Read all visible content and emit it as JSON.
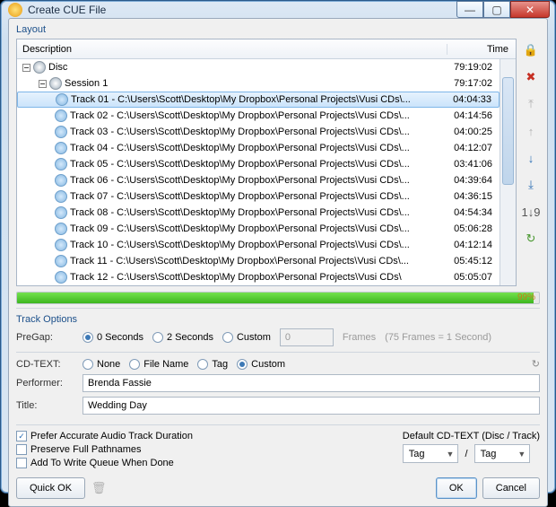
{
  "window": {
    "title": "Create CUE File"
  },
  "layout": {
    "label": "Layout",
    "columns": {
      "description": "Description",
      "time": "Time"
    },
    "root": {
      "label": "Disc",
      "time": "79:19:02"
    },
    "session": {
      "label": "Session 1",
      "time": "79:17:02"
    },
    "tracks": [
      {
        "label": "Track 01 - C:\\Users\\Scott\\Desktop\\My Dropbox\\Personal Projects\\Vusi CDs\\...",
        "time": "04:04:33",
        "selected": true
      },
      {
        "label": "Track 02 - C:\\Users\\Scott\\Desktop\\My Dropbox\\Personal Projects\\Vusi CDs\\...",
        "time": "04:14:56"
      },
      {
        "label": "Track 03 - C:\\Users\\Scott\\Desktop\\My Dropbox\\Personal Projects\\Vusi CDs\\...",
        "time": "04:00:25"
      },
      {
        "label": "Track 04 - C:\\Users\\Scott\\Desktop\\My Dropbox\\Personal Projects\\Vusi CDs\\...",
        "time": "04:12:07"
      },
      {
        "label": "Track 05 - C:\\Users\\Scott\\Desktop\\My Dropbox\\Personal Projects\\Vusi CDs\\...",
        "time": "03:41:06"
      },
      {
        "label": "Track 06 - C:\\Users\\Scott\\Desktop\\My Dropbox\\Personal Projects\\Vusi CDs\\...",
        "time": "04:39:64"
      },
      {
        "label": "Track 07 - C:\\Users\\Scott\\Desktop\\My Dropbox\\Personal Projects\\Vusi CDs\\...",
        "time": "04:36:15"
      },
      {
        "label": "Track 08 - C:\\Users\\Scott\\Desktop\\My Dropbox\\Personal Projects\\Vusi CDs\\...",
        "time": "04:54:34"
      },
      {
        "label": "Track 09 - C:\\Users\\Scott\\Desktop\\My Dropbox\\Personal Projects\\Vusi CDs\\...",
        "time": "05:06:28"
      },
      {
        "label": "Track 10 - C:\\Users\\Scott\\Desktop\\My Dropbox\\Personal Projects\\Vusi CDs\\...",
        "time": "04:12:14"
      },
      {
        "label": "Track 11 - C:\\Users\\Scott\\Desktop\\My Dropbox\\Personal Projects\\Vusi CDs\\...",
        "time": "05:45:12"
      },
      {
        "label": "Track 12 - C:\\Users\\Scott\\Desktop\\My Dropbox\\Personal Projects\\Vusi CDs\\",
        "time": "05:05:07"
      }
    ]
  },
  "progress": {
    "percent": "99%"
  },
  "track_options": {
    "header": "Track Options",
    "pregap_label": "PreGap:",
    "pregap": {
      "opt0": "0 Seconds",
      "opt2": "2 Seconds",
      "optc": "Custom",
      "value": "0",
      "unit": "Frames",
      "hint": "(75 Frames = 1 Second)"
    },
    "cdtext_label": "CD-TEXT:",
    "cdtext": {
      "none": "None",
      "file": "File Name",
      "tag": "Tag",
      "custom": "Custom"
    },
    "performer_label": "Performer:",
    "performer": "Brenda Fassie",
    "title_label": "Title:",
    "title": "Wedding Day"
  },
  "checks": {
    "accurate": "Prefer Accurate Audio Track Duration",
    "preserve": "Preserve Full Pathnames",
    "queue": "Add To Write Queue When Done"
  },
  "default_cdtext": {
    "label": "Default CD-TEXT (Disc / Track)",
    "disc": "Tag",
    "track": "Tag",
    "sep": "/"
  },
  "buttons": {
    "quick_ok": "Quick OK",
    "ok": "OK",
    "cancel": "Cancel"
  }
}
